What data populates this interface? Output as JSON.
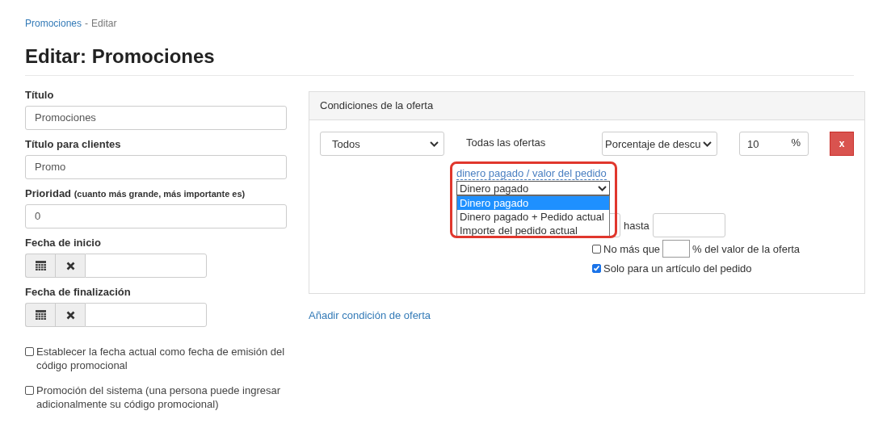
{
  "breadcrumb": {
    "link": "Promociones",
    "separator": "-",
    "current": "Editar"
  },
  "title": "Editar: Promociones",
  "fields": [
    {
      "kind": "text",
      "label": "Título",
      "value": "Promociones"
    },
    {
      "kind": "text",
      "label": "Título para clientes",
      "value": "Promo"
    },
    {
      "kind": "text",
      "label": "Prioridad",
      "hint": "(cuanto más grande, más importante es)",
      "value": "0"
    },
    {
      "kind": "date",
      "label": "Fecha de inicio"
    },
    {
      "kind": "date",
      "label": "Fecha de finalización"
    }
  ],
  "checkboxes": [
    {
      "label": "Establecer la fecha actual como fecha de emisión del código promocional",
      "checked": false
    },
    {
      "label": "Promoción del sistema (una persona puede ingresar adicionalmente su código promocional)",
      "checked": false
    }
  ],
  "conditions_panel": {
    "header": "Condiciones de la oferta",
    "scope_select": "Todos",
    "offers_text": "Todas las ofertas",
    "discount_type_select": "Porcentaje de descu",
    "discount_value": "10",
    "discount_unit": "%",
    "remove_button": "x",
    "basis_link": "dinero pagado / valor del pedido",
    "basis_select": {
      "value": "Dinero pagado",
      "expanded": true,
      "options": [
        {
          "label": "Dinero pagado",
          "selected": true
        },
        {
          "label": "Dinero pagado + Pedido actual",
          "selected": false
        },
        {
          "label": "Importe del pedido actual",
          "selected": false
        }
      ]
    },
    "range_to_label": "hasta",
    "limit_checkbox": {
      "label": "No más que",
      "suffix": "% del valor de la oferta",
      "checked": false
    },
    "single_item_checkbox": {
      "label": "Solo para un artículo del pedido",
      "checked": true
    }
  },
  "add_condition_link": "Añadir condición de oferta"
}
